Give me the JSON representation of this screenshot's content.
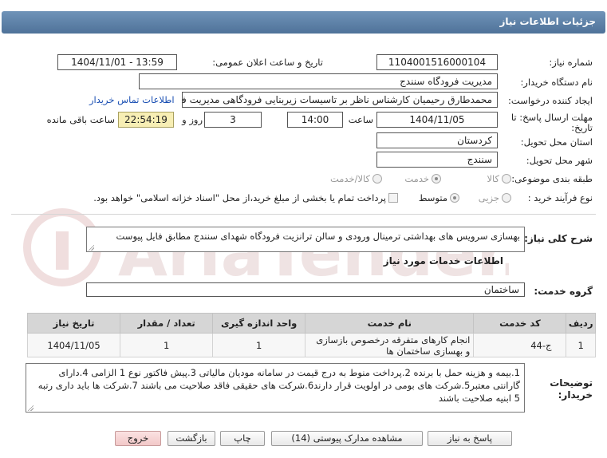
{
  "header": {
    "title": "جزئیات اطلاعات نیاز"
  },
  "fields": {
    "need_number_label": "شماره نیاز:",
    "need_number": "1104001516000104",
    "announce_label": "تاریخ و ساعت اعلان عمومی:",
    "announce_value": "1404/11/01 - 13:59",
    "buyer_label": "نام دستگاه خریدار:",
    "buyer_value": "مدیریت فرودگاه سنندج",
    "creator_label": "ایجاد کننده درخواست:",
    "creator_value": "محمدطارق رحیمیان کارشناس ناظر بر تاسیسات زیربنایی فرودگاهی مدیریت فرودگاه سنندج",
    "contact_link": "اطلاعات تماس خریدار",
    "deadline_label_1": "مهلت ارسال پاسخ: تا",
    "deadline_label_2": "تاریخ:",
    "deadline_date": "1404/11/05",
    "time_label": "ساعت",
    "deadline_time": "14:00",
    "days_value": "3",
    "days_label": "روز و",
    "remaining_time": "22:54:19",
    "remaining_label": "ساعت باقی مانده",
    "province_label": "استان محل تحویل:",
    "province_value": "کردستان",
    "city_label": "شهر محل تحویل:",
    "city_value": "سنندج",
    "category_label": "طبقه بندی موضوعی:",
    "category_options": [
      "کالا",
      "خدمت",
      "کالا/خدمت"
    ],
    "process_label": "نوع فرآیند خرید :",
    "process_options": [
      "جزیی",
      "متوسط"
    ],
    "process_note": "پرداخت تمام یا بخشی از مبلغ خرید،از محل \"اسناد خزانه اسلامی\" خواهد بود."
  },
  "description": {
    "label": "شرح کلی نیاز:",
    "value": "بهسازی سرویس های بهداشتی ترمینال ورودی و سالن ترانزیت فرودگاه شهدای سنندج مطابق فایل پیوست"
  },
  "services_section": {
    "title": "اطلاعات خدمات مورد نیاز"
  },
  "service_group": {
    "label": "گروه خدمت:",
    "value": "ساختمان"
  },
  "table": {
    "headers": [
      "ردیف",
      "کد خدمت",
      "نام خدمت",
      "واحد اندازه گیری",
      "تعداد / مقدار",
      "تاریخ نیاز"
    ],
    "rows": [
      [
        "1",
        "ج-44",
        "انجام کارهای متفرقه درخصوص بازسازی و بهسازی ساختمان ها",
        "1",
        "1",
        "1404/11/05"
      ]
    ]
  },
  "buyer_notes": {
    "label_1": "توضیحات",
    "label_2": "خریدار:",
    "value": "1.بیمه و هزینه حمل با برنده 2.پرداخت منوط به درج قیمت در سامانه مودیان مالیاتی 3.پیش فاکتور نوع 1 الزامی 4.دارای گارانتی معتبر5.شرکت های بومی در اولویت قرار دارند6.شرکت های حقیقی فاقد صلاحیت می باشند 7.شرکت ها باید داری رتبه 5 ابنیه صلاحیت باشند"
  },
  "buttons": {
    "reply": "پاسخ به نیاز",
    "view_docs": "مشاهده مدارک پیوستی (14)",
    "print": "چاپ",
    "back": "بازگشت",
    "exit": "خروج"
  },
  "colors": {
    "header_band": "#5b7fa6",
    "remaining_bg": "#f7eeb4",
    "link": "#1a4fb3",
    "exit_bg": "#f2c8c8"
  }
}
